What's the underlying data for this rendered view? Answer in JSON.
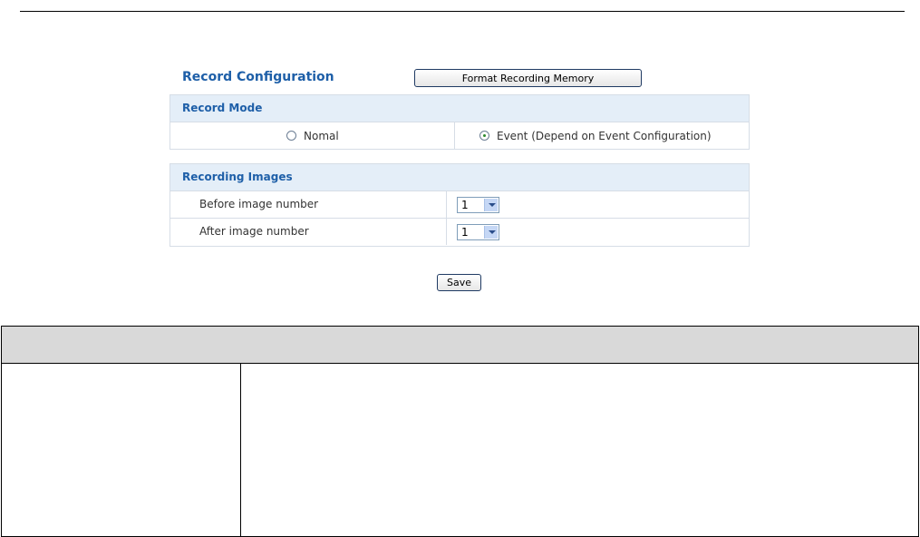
{
  "config": {
    "title": "Record Configuration",
    "format_button_label": "Format Recording Memory",
    "save_label": "Save"
  },
  "record_mode": {
    "header": "Record Mode",
    "options": [
      {
        "label": "Nomal",
        "checked": false
      },
      {
        "label": "Event (Depend on Event Configuration)",
        "checked": true
      }
    ]
  },
  "recording_images": {
    "header": "Recording Images",
    "rows": [
      {
        "label": "Before image number",
        "value": "1"
      },
      {
        "label": "After image number",
        "value": "1"
      }
    ]
  },
  "colors": {
    "accent_text": "#1e5fa8",
    "panel_header_bg": "#e4eef8",
    "doc_header_bg": "#d9d9d9"
  }
}
